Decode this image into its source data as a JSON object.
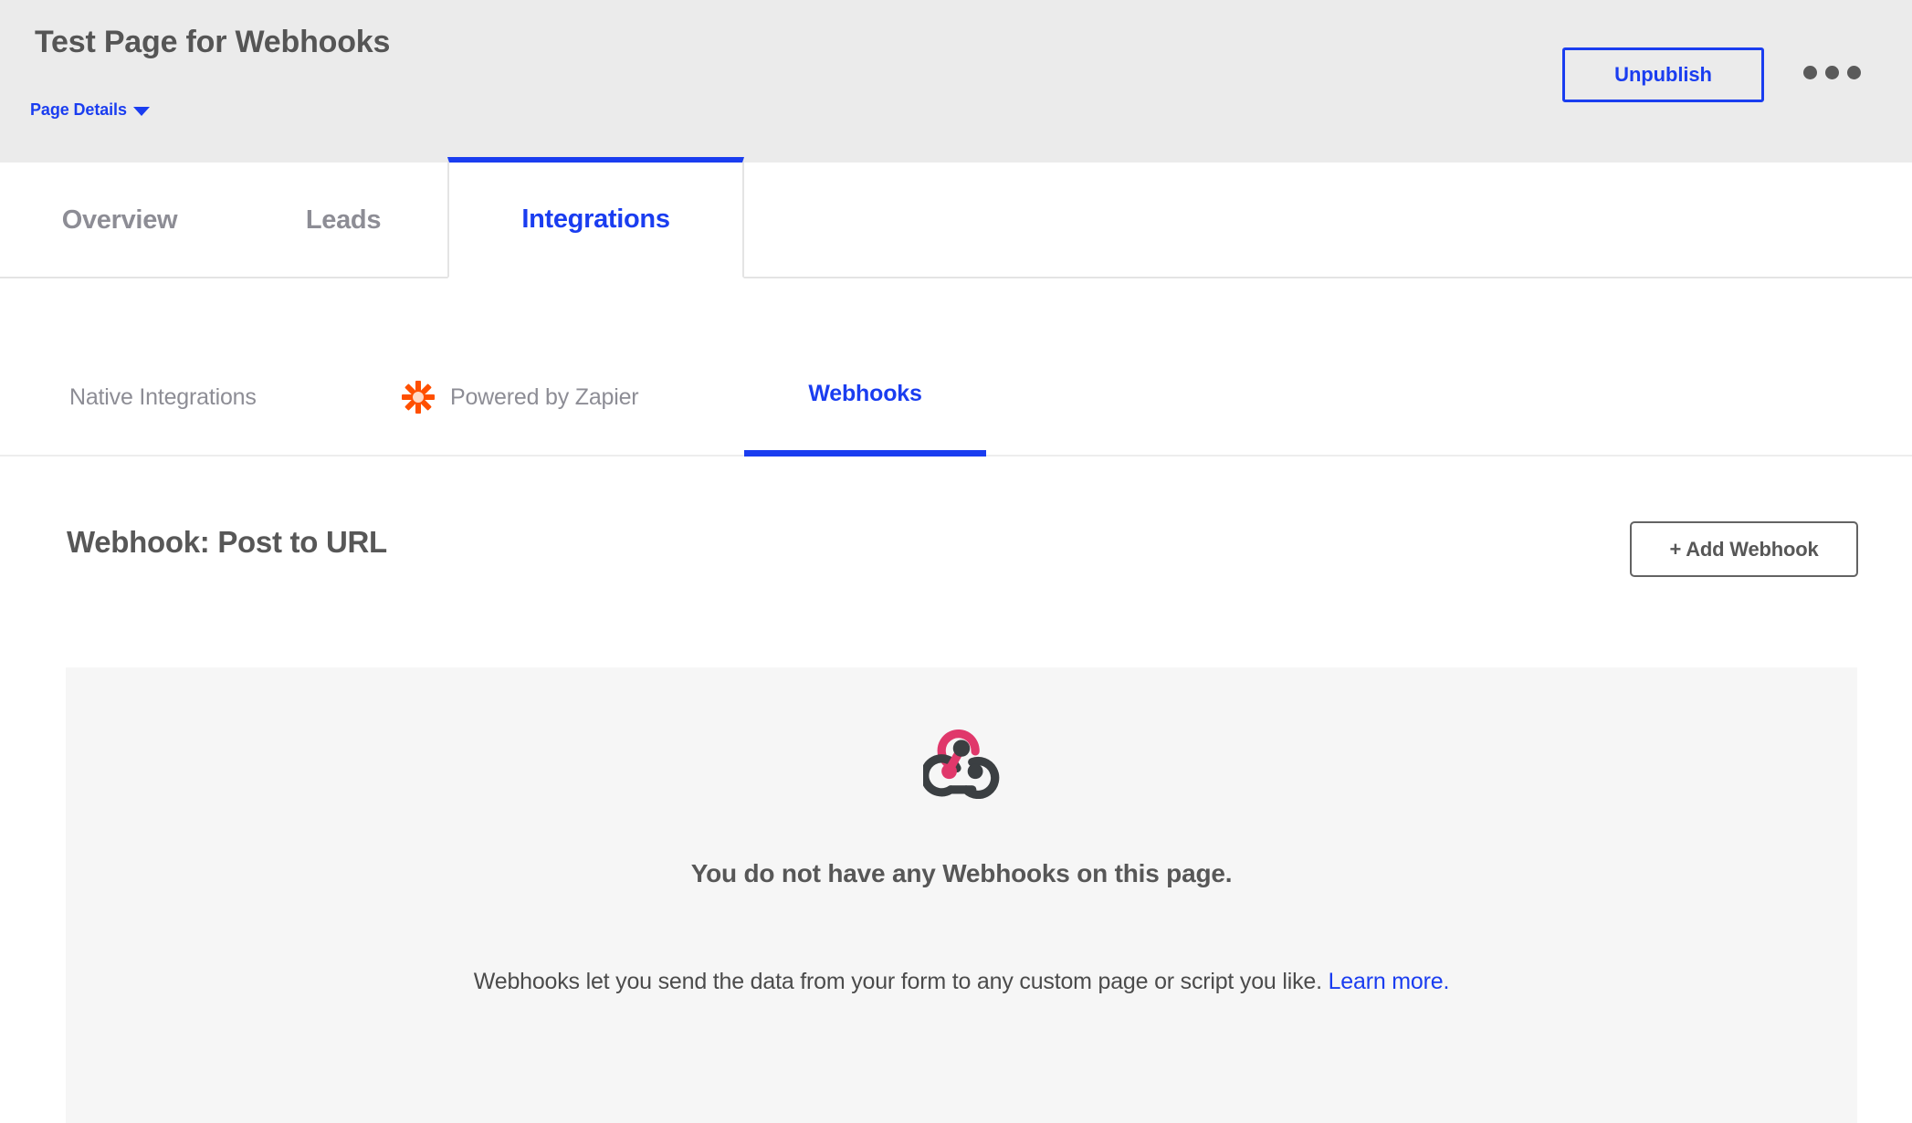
{
  "header": {
    "title": "Test Page for Webhooks",
    "page_details_label": "Page Details",
    "page_details_icon": "chevron-down-icon",
    "unpublish_label": "Unpublish",
    "more_menu_icon": "kebab-menu-icon",
    "background_color": "#ebebeb",
    "accent_color": "#1a3df0"
  },
  "main_tabs": [
    {
      "label": "Overview",
      "active": false
    },
    {
      "label": "Leads",
      "active": false
    },
    {
      "label": "Integrations",
      "active": true
    }
  ],
  "sub_tabs": [
    {
      "label": "Native Integrations",
      "active": false,
      "icon": null
    },
    {
      "label": "Powered by Zapier",
      "active": false,
      "icon": "zapier-asterisk-icon",
      "icon_color": "#ff4f00"
    },
    {
      "label": "Webhooks",
      "active": true,
      "icon": null
    }
  ],
  "content": {
    "section_title": "Webhook: Post to URL",
    "add_webhook_label": "+ Add Webhook",
    "empty_state": {
      "icon": "webhook-logo-icon",
      "icon_colors": {
        "accent": "#e0386b",
        "base": "#3b3f42"
      },
      "heading": "You do not have any Webhooks on this page.",
      "description": "Webhooks let you send the data from your form to any custom page or script you like.",
      "link_label": "Learn more.",
      "panel_color": "#f6f6f6"
    }
  }
}
